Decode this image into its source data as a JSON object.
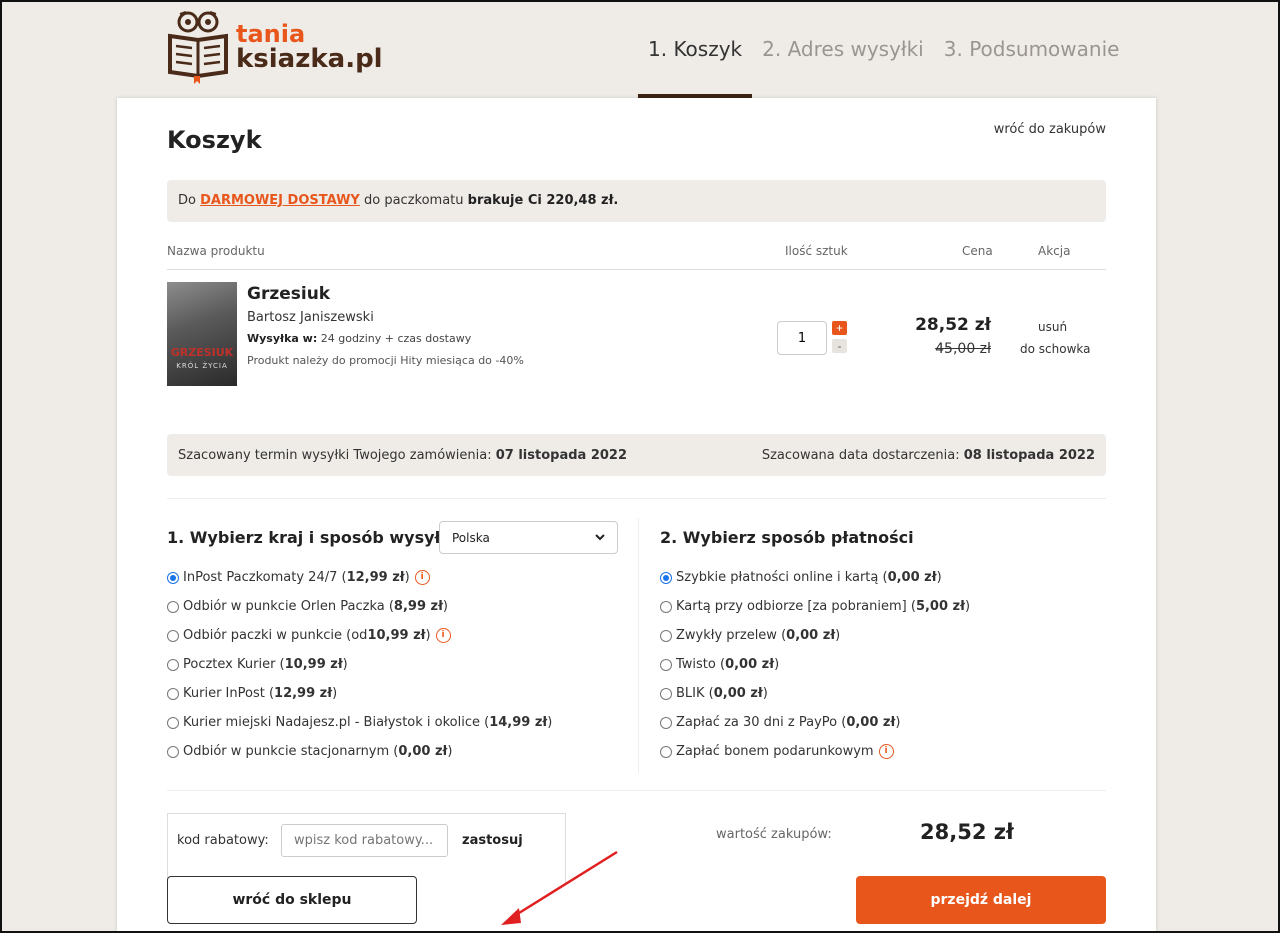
{
  "logo": {
    "line1": "tania",
    "line2": "ksiazka.pl"
  },
  "steps": [
    "1. Koszyk",
    "2. Adres wysyłki",
    "3. Podsumowanie"
  ],
  "cart": {
    "title": "Koszyk",
    "back_link": "wróć do zakupów",
    "notice": {
      "prefix": "Do",
      "free": "DARMOWEJ DOSTAWY",
      "middle": "do paczkomatu",
      "missing": "brakuje Ci 220,48 zł."
    },
    "columns": {
      "name": "Nazwa produktu",
      "qty": "Ilość sztuk",
      "price": "Cena",
      "action": "Akcja"
    },
    "product": {
      "cover_title": "GRZESIUK",
      "cover_subtitle": "KRÓL ŻYCIA",
      "name": "Grzesiuk",
      "author": "Bartosz Janiszewski",
      "ship_label": "Wysyłka w:",
      "ship_value": "24 godziny + czas dostawy",
      "promo": "Produkt należy do promocji Hity miesiąca do -40%",
      "qty": "1",
      "plus": "+",
      "minus": "-",
      "price": "28,52 zł",
      "old_price": "45,00 zł",
      "remove": "usuń",
      "save": "do schowka"
    },
    "dates": {
      "ship_label": "Szacowany termin wysyłki Twojego zamówienia:",
      "ship_date": "07 listopada 2022",
      "delivery_label": "Szacowana data dostarczenia:",
      "delivery_date": "08 listopada 2022"
    }
  },
  "shipping": {
    "title": "1. Wybierz kraj i sposób wysyłki",
    "country": "Polska",
    "options": [
      {
        "name": "InPost Paczkomaty 24/7 (",
        "price": "12,99 zł",
        "end": ")"
      },
      {
        "name": "Odbiór w punkcie Orlen Paczka (",
        "price": "8,99 zł",
        "end": ")"
      },
      {
        "name": "Odbiór paczki w punkcie (od ",
        "price": "10,99 zł",
        "end": ")"
      },
      {
        "name": "Pocztex Kurier (",
        "price": "10,99 zł",
        "end": ")"
      },
      {
        "name": "Kurier InPost (",
        "price": "12,99 zł",
        "end": ")"
      },
      {
        "name": "Kurier miejski Nadajesz.pl - Białystok i okolice (",
        "price": "14,99 zł",
        "end": ")"
      },
      {
        "name": "Odbiór w punkcie stacjonarnym (",
        "price": "0,00 zł",
        "end": ")"
      }
    ]
  },
  "payment": {
    "title": "2. Wybierz sposób płatności",
    "options": [
      {
        "name": "Szybkie płatności online i kartą (",
        "price": "0,00 zł",
        "end": ")"
      },
      {
        "name": "Kartą przy odbiorze [za pobraniem] (",
        "price": "5,00 zł",
        "end": ")"
      },
      {
        "name": "Zwykły przelew (",
        "price": "0,00 zł",
        "end": ")"
      },
      {
        "name": "Twisto (",
        "price": "0,00 zł",
        "end": ")"
      },
      {
        "name": "BLIK (",
        "price": "0,00 zł",
        "end": ")"
      },
      {
        "name": "Zapłać za 30 dni z PayPo (",
        "price": "0,00 zł",
        "end": ")"
      },
      {
        "name": "Zapłać bonem podarunkowym",
        "price": "",
        "end": ""
      }
    ]
  },
  "promo": {
    "label": "kod rabatowy:",
    "placeholder": "wpisz kod rabatowy...",
    "apply": "zastosuj"
  },
  "summary": {
    "label": "wartość zakupów:",
    "value": "28,52 zł"
  },
  "buttons": {
    "back": "wróć do sklepu",
    "next": "przejdź dalej"
  },
  "colors": {
    "accent": "#e8561c",
    "brand_dark": "#4a2a18",
    "bg": "#efece7"
  }
}
